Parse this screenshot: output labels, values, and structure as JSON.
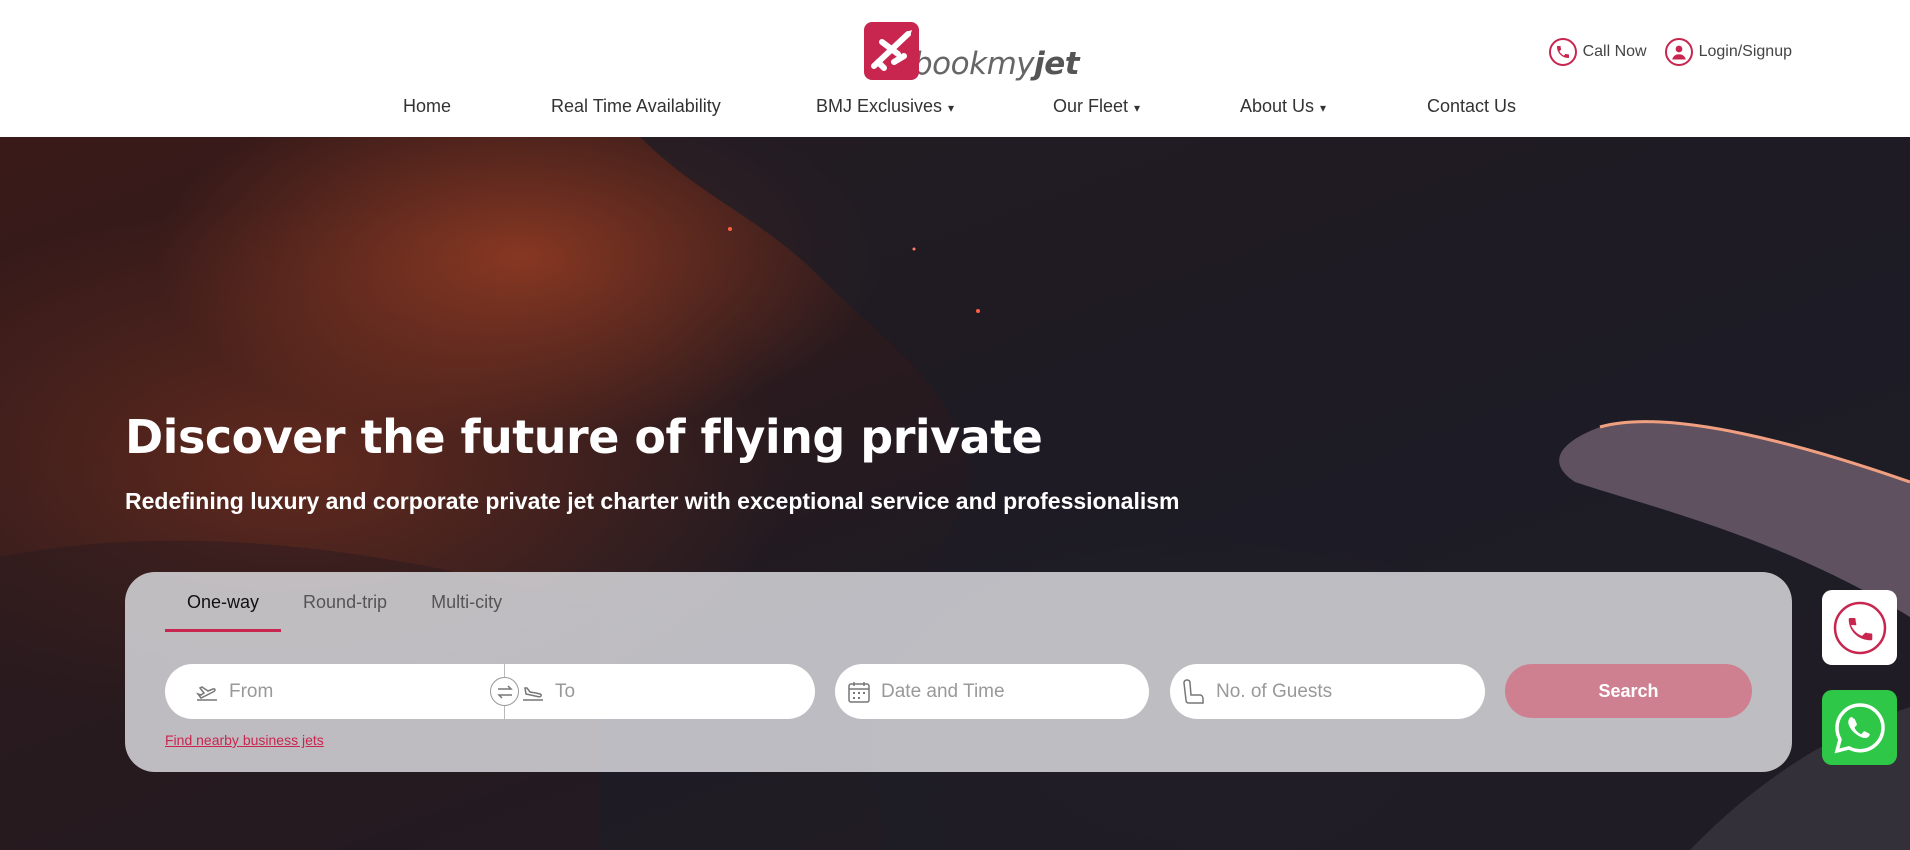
{
  "brand": {
    "name_light": "bookmy",
    "name_bold": "jet",
    "accent": "#c8264f"
  },
  "top_actions": {
    "call": "Call Now",
    "login": "Login/Signup"
  },
  "nav": {
    "home": "Home",
    "availability": "Real Time Availability",
    "exclusives": "BMJ Exclusives",
    "fleet": "Our Fleet",
    "about": "About Us",
    "contact": "Contact Us",
    "caret": "▾"
  },
  "hero": {
    "title": "Discover the future of flying private",
    "subtitle": "Redefining luxury and corporate private jet charter with exceptional service and professionalism"
  },
  "search": {
    "tabs": [
      "One-way",
      "Round-trip",
      "Multi-city"
    ],
    "active_tab": "One-way",
    "from_placeholder": "From",
    "to_placeholder": "To",
    "date_placeholder": "Date and Time",
    "guests_placeholder": "No. of Guests",
    "button": "Search",
    "nearby_link": "Find nearby business jets"
  },
  "floating": {
    "call_icon": "phone-icon",
    "whatsapp_icon": "whatsapp-icon"
  }
}
